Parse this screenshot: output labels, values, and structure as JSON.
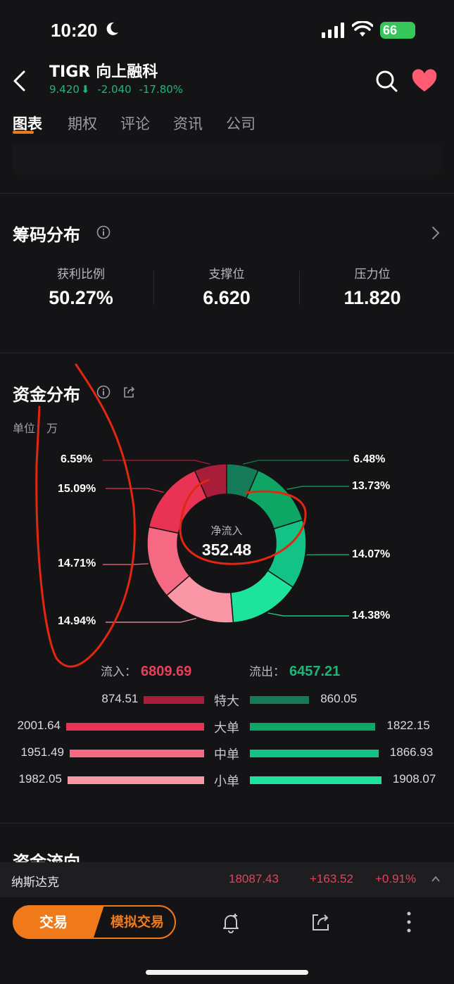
{
  "status": {
    "time": "10:20",
    "battery": "66"
  },
  "header": {
    "ticker": "TIGR",
    "name": "向上融科",
    "price": "9.420",
    "change": "-2.040",
    "change_pct": "-17.80%"
  },
  "tabs": [
    "图表",
    "期权",
    "评论",
    "资讯",
    "公司"
  ],
  "chip_distribution": {
    "title": "筹码分布",
    "stats": [
      {
        "label": "获利比例",
        "value": "50.27%"
      },
      {
        "label": "支撑位",
        "value": "6.620"
      },
      {
        "label": "压力位",
        "value": "11.820"
      }
    ]
  },
  "fund_distribution": {
    "title": "资金分布",
    "unit": "单位：万",
    "net_label": "净流入",
    "net_value": "352.48",
    "inflow_label": "流入：",
    "inflow_total": "6809.69",
    "outflow_label": "流出：",
    "outflow_total": "6457.21",
    "colors": {
      "inflow": [
        "#a81e3a",
        "#e83355",
        "#f56a82",
        "#fa97a6"
      ],
      "outflow": [
        "#157a58",
        "#0ea664",
        "#12c286",
        "#1ee39c"
      ]
    },
    "rows": [
      {
        "category": "特大",
        "inflow": "874.51",
        "outflow": "860.05"
      },
      {
        "category": "大单",
        "inflow": "2001.64",
        "outflow": "1822.15"
      },
      {
        "category": "中单",
        "inflow": "1951.49",
        "outflow": "1866.93"
      },
      {
        "category": "小单",
        "inflow": "1982.05",
        "outflow": "1908.07"
      }
    ],
    "pct_in": [
      "6.59%",
      "15.09%",
      "14.71%",
      "14.94%"
    ],
    "pct_out": [
      "6.48%",
      "13.73%",
      "14.07%",
      "14.38%"
    ]
  },
  "chart_data": {
    "type": "pie",
    "labels": [
      "特大流入",
      "大单流入",
      "中单流入",
      "小单流入",
      "小单流出",
      "中单流出",
      "大单流出",
      "特大流出"
    ],
    "values": [
      6.59,
      15.09,
      14.71,
      14.94,
      14.38,
      14.07,
      13.73,
      6.48
    ]
  },
  "next_section": {
    "title": "资金流向"
  },
  "index_bar": {
    "name": "纳斯达克",
    "value": "18087.43",
    "change": "+163.52",
    "change_pct": "+0.91%"
  },
  "bottom": {
    "trade": "交易",
    "sim_trade": "模拟交易"
  }
}
